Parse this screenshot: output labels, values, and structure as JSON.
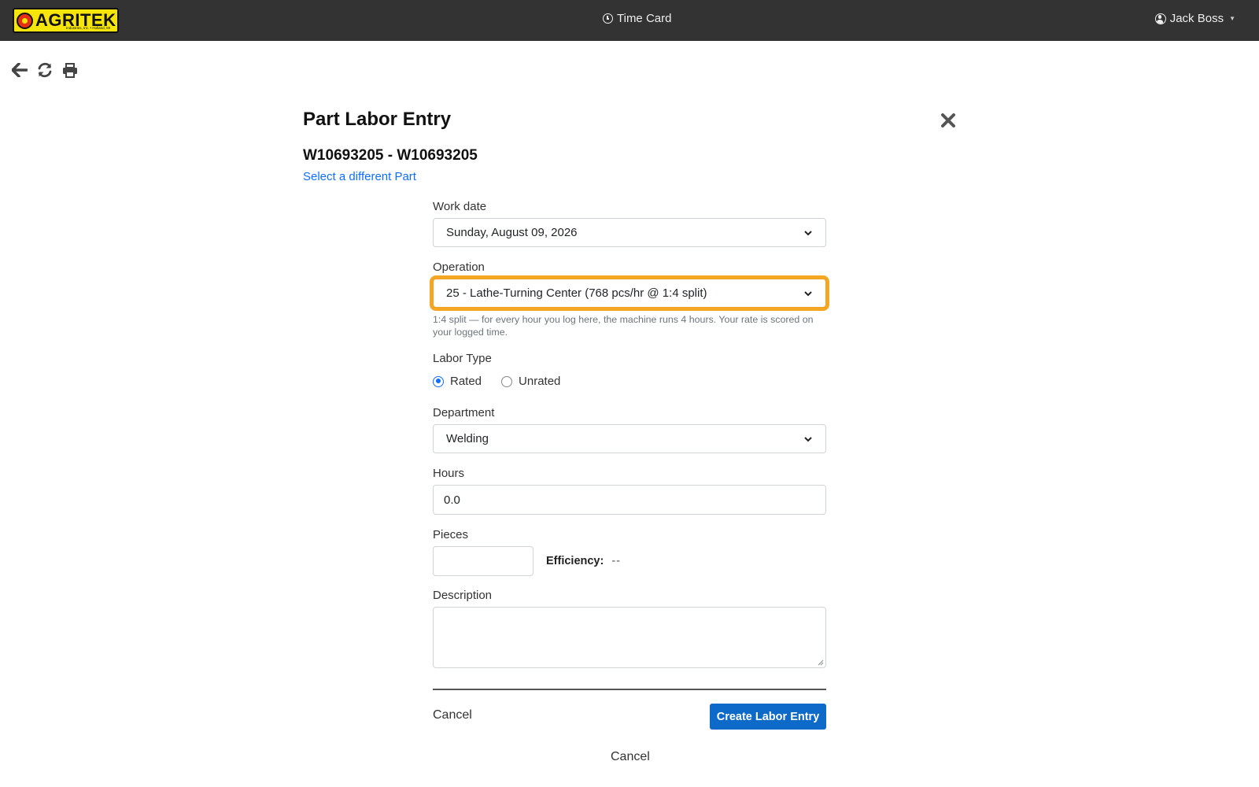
{
  "header": {
    "logo_text": "AGRITEK",
    "logo_subtext": "Industries, Inc. • Holland, MI",
    "title": "Time Card",
    "user_name": "Jack Boss"
  },
  "toolbar": {
    "icons": [
      "back-arrow-icon",
      "refresh-icon",
      "print-icon"
    ]
  },
  "panel": {
    "title": "Part Labor Entry",
    "part": "W10693205 - W10693205",
    "change_part_link": "Select a different Part"
  },
  "form": {
    "work_date": {
      "label": "Work date",
      "value": "Sunday, August 09, 2026"
    },
    "operation": {
      "label": "Operation",
      "value": "25 - Lathe-Turning Center (768 pcs/hr @ 1:4 split)",
      "help": "1:4 split — for every hour you log here, the machine runs 4 hours. Your rate is scored on your logged time."
    },
    "labor_type": {
      "label": "Labor Type",
      "options": [
        "Rated",
        "Unrated"
      ],
      "selected": "Rated"
    },
    "department": {
      "label": "Department",
      "value": "Welding"
    },
    "hours": {
      "label": "Hours",
      "value": "0.0"
    },
    "pieces": {
      "label": "Pieces",
      "value": ""
    },
    "efficiency": {
      "label": "Efficiency:",
      "value": "--"
    },
    "description": {
      "label": "Description",
      "value": ""
    },
    "cancel_label": "Cancel",
    "submit_label": "Create Labor Entry"
  },
  "footer": {
    "cancel_label": "Cancel"
  },
  "colors": {
    "topbar": "#333333",
    "accent": "#0d6ac8",
    "focus_ring": "#f5a623",
    "link": "#0d6efd"
  }
}
